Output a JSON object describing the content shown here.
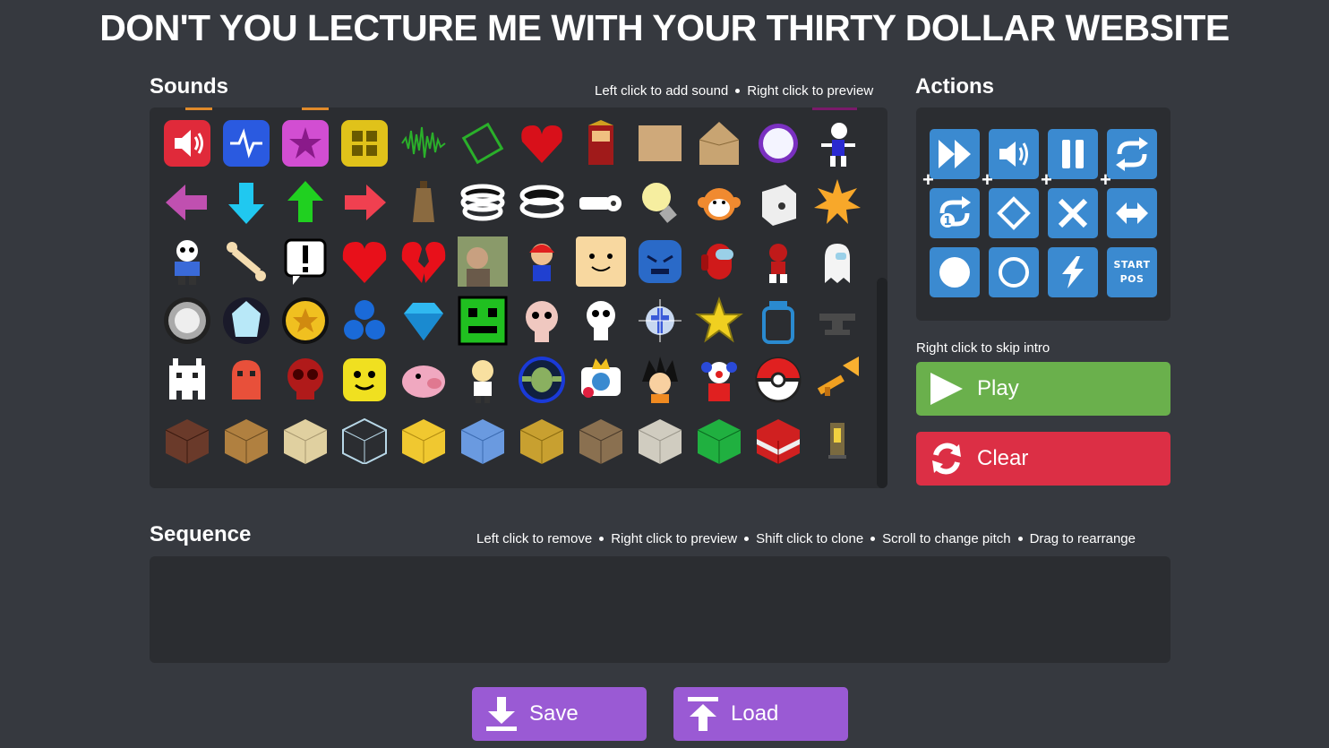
{
  "page": {
    "title": "DON'T YOU LECTURE ME WITH YOUR THIRTY DOLLAR WEBSITE"
  },
  "sounds": {
    "heading": "Sounds",
    "hint_left": "Left click to add sound",
    "hint_right": "Right click to preview",
    "icons": [
      "speaker-icon",
      "pulse-icon",
      "star-badge-icon",
      "grid-icon",
      "waveform-icon",
      "diamond-outline-icon",
      "pixel-heart-icon",
      "samurai-icon",
      "sandpaper-icon",
      "cardboard-box-icon",
      "glowing-orb-icon",
      "skeleton-dancer-icon",
      "arrow-left-icon",
      "arrow-down-icon",
      "arrow-up-icon",
      "arrow-right-icon",
      "cowbell-icon",
      "spring-icon",
      "coil-icon",
      "whistle-icon",
      "lightbulb-icon",
      "monkey-icon",
      "die-icon",
      "burst-icon",
      "sans-icon",
      "bone-icon",
      "speech-alert-icon",
      "heart-icon",
      "broken-heart-icon",
      "photo-icon",
      "mario-icon",
      "face-icon",
      "blue-monster-icon",
      "crewmate-icon",
      "robot-icon",
      "ghost-icon",
      "ring-button-icon",
      "crystal-icon",
      "coin-icon",
      "blue-orbs-icon",
      "gem-icon",
      "geometry-face-icon",
      "isaac-icon",
      "skull-ghost-icon",
      "holy-cross-icon",
      "gold-star-icon",
      "jar-icon",
      "anvil-icon",
      "space-invader-icon",
      "red-ghost-icon",
      "red-skull-icon",
      "noob-head-icon",
      "pig-icon",
      "anime-girl-icon",
      "yoda-icon",
      "king-icon",
      "goku-icon",
      "clown-icon",
      "pokeball-icon",
      "trumpet-icon",
      "note-block-icon",
      "wood-plank-icon",
      "sand-block-icon",
      "glass-block-icon",
      "gold-block-icon",
      "ice-block-icon",
      "hay-block-icon",
      "gravel-block-icon",
      "stone-block-icon",
      "emerald-block-icon",
      "tnt-block-icon",
      "bell-icon"
    ]
  },
  "actions": {
    "heading": "Actions",
    "items": [
      {
        "name": "speed-icon",
        "plus": "+"
      },
      {
        "name": "volume-icon",
        "plus": "+"
      },
      {
        "name": "pause-icon",
        "plus": "+"
      },
      {
        "name": "loop-icon",
        "plus": "+"
      },
      {
        "name": "loop-once-icon",
        "plus": ""
      },
      {
        "name": "target-diamond-icon",
        "plus": ""
      },
      {
        "name": "cancel-x-icon",
        "plus": ""
      },
      {
        "name": "transpose-icon",
        "plus": ""
      },
      {
        "name": "dot-icon",
        "plus": ""
      },
      {
        "name": "circle-outline-icon",
        "plus": ""
      },
      {
        "name": "lightning-icon",
        "plus": ""
      },
      {
        "name": "start-pos-icon",
        "plus": "",
        "label": "START POS"
      }
    ],
    "skip_hint": "Right click to skip intro",
    "play_label": "Play",
    "clear_label": "Clear"
  },
  "sequence": {
    "heading": "Sequence",
    "hints": [
      "Left click to remove",
      "Right click to preview",
      "Shift click to clone",
      "Scroll to change pitch",
      "Drag to rearrange"
    ]
  },
  "footer": {
    "save_label": "Save",
    "load_label": "Load"
  },
  "colors": {
    "background": "#36393f",
    "panel": "#2b2d31",
    "action_blue": "#3b8ad0",
    "play_green": "#6ab04c",
    "clear_red": "#dc2f45",
    "purple": "#9a5ad4"
  }
}
